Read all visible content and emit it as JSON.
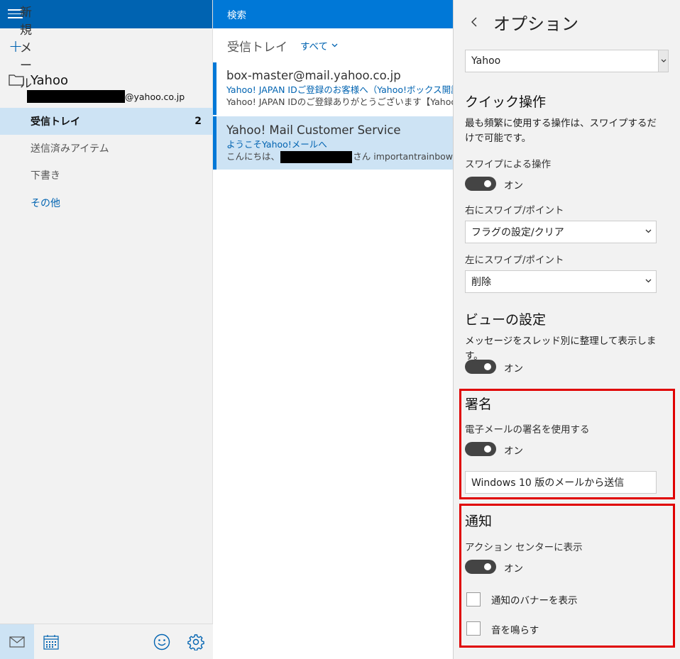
{
  "nav": {
    "new_mail_label": "新規メール",
    "account": {
      "name": "Yahoo",
      "email_suffix": "@yahoo.co.jp"
    },
    "folders": [
      {
        "label": "受信トレイ",
        "count": "2"
      },
      {
        "label": "送信済みアイテム"
      },
      {
        "label": "下書き"
      },
      {
        "label": "その他"
      }
    ],
    "bottom_icons": [
      "mail-icon",
      "calendar-icon",
      "smiley-icon",
      "gear-icon"
    ]
  },
  "list": {
    "search_placeholder": "検索",
    "title": "受信トレイ",
    "filter_label": "すべて",
    "messages": [
      {
        "from": "box-master@mail.yahoo.co.jp",
        "subject": "Yahoo! JAPAN IDご登録のお客様へ（Yahoo!ボックス開設に",
        "preview": "Yahoo! JAPAN IDのご登録ありがとうございます【Yahoo!ボックス"
      },
      {
        "from": "Yahoo! Mail Customer Service",
        "subject": "ようこそYahoo!メールへ",
        "preview_before": "こんにちは、",
        "preview_after": "さん importantrainbow"
      }
    ]
  },
  "options": {
    "title": "オプション",
    "account_select": "Yahoo",
    "quick_actions": {
      "title": "クイック操作",
      "description": "最も頻繁に使用する操作は、スワイプするだけで可能です。",
      "swipe_label": "スワイプによる操作",
      "swipe_state": "オン",
      "right_label": "右にスワイプ/ポイント",
      "right_value": "フラグの設定/クリア",
      "left_label": "左にスワイプ/ポイント",
      "left_value": "削除"
    },
    "view": {
      "title": "ビューの設定",
      "description": "メッセージをスレッド別に整理して表示します。",
      "state": "オン"
    },
    "signature": {
      "title": "署名",
      "label": "電子メールの署名を使用する",
      "state": "オン",
      "value": "Windows 10 版のメールから送信"
    },
    "notifications": {
      "title": "通知",
      "label": "アクション センターに表示",
      "state": "オン",
      "banner_label": "通知のバナーを表示",
      "sound_label": "音を鳴らす"
    },
    "highlight_color": "#e00000"
  }
}
